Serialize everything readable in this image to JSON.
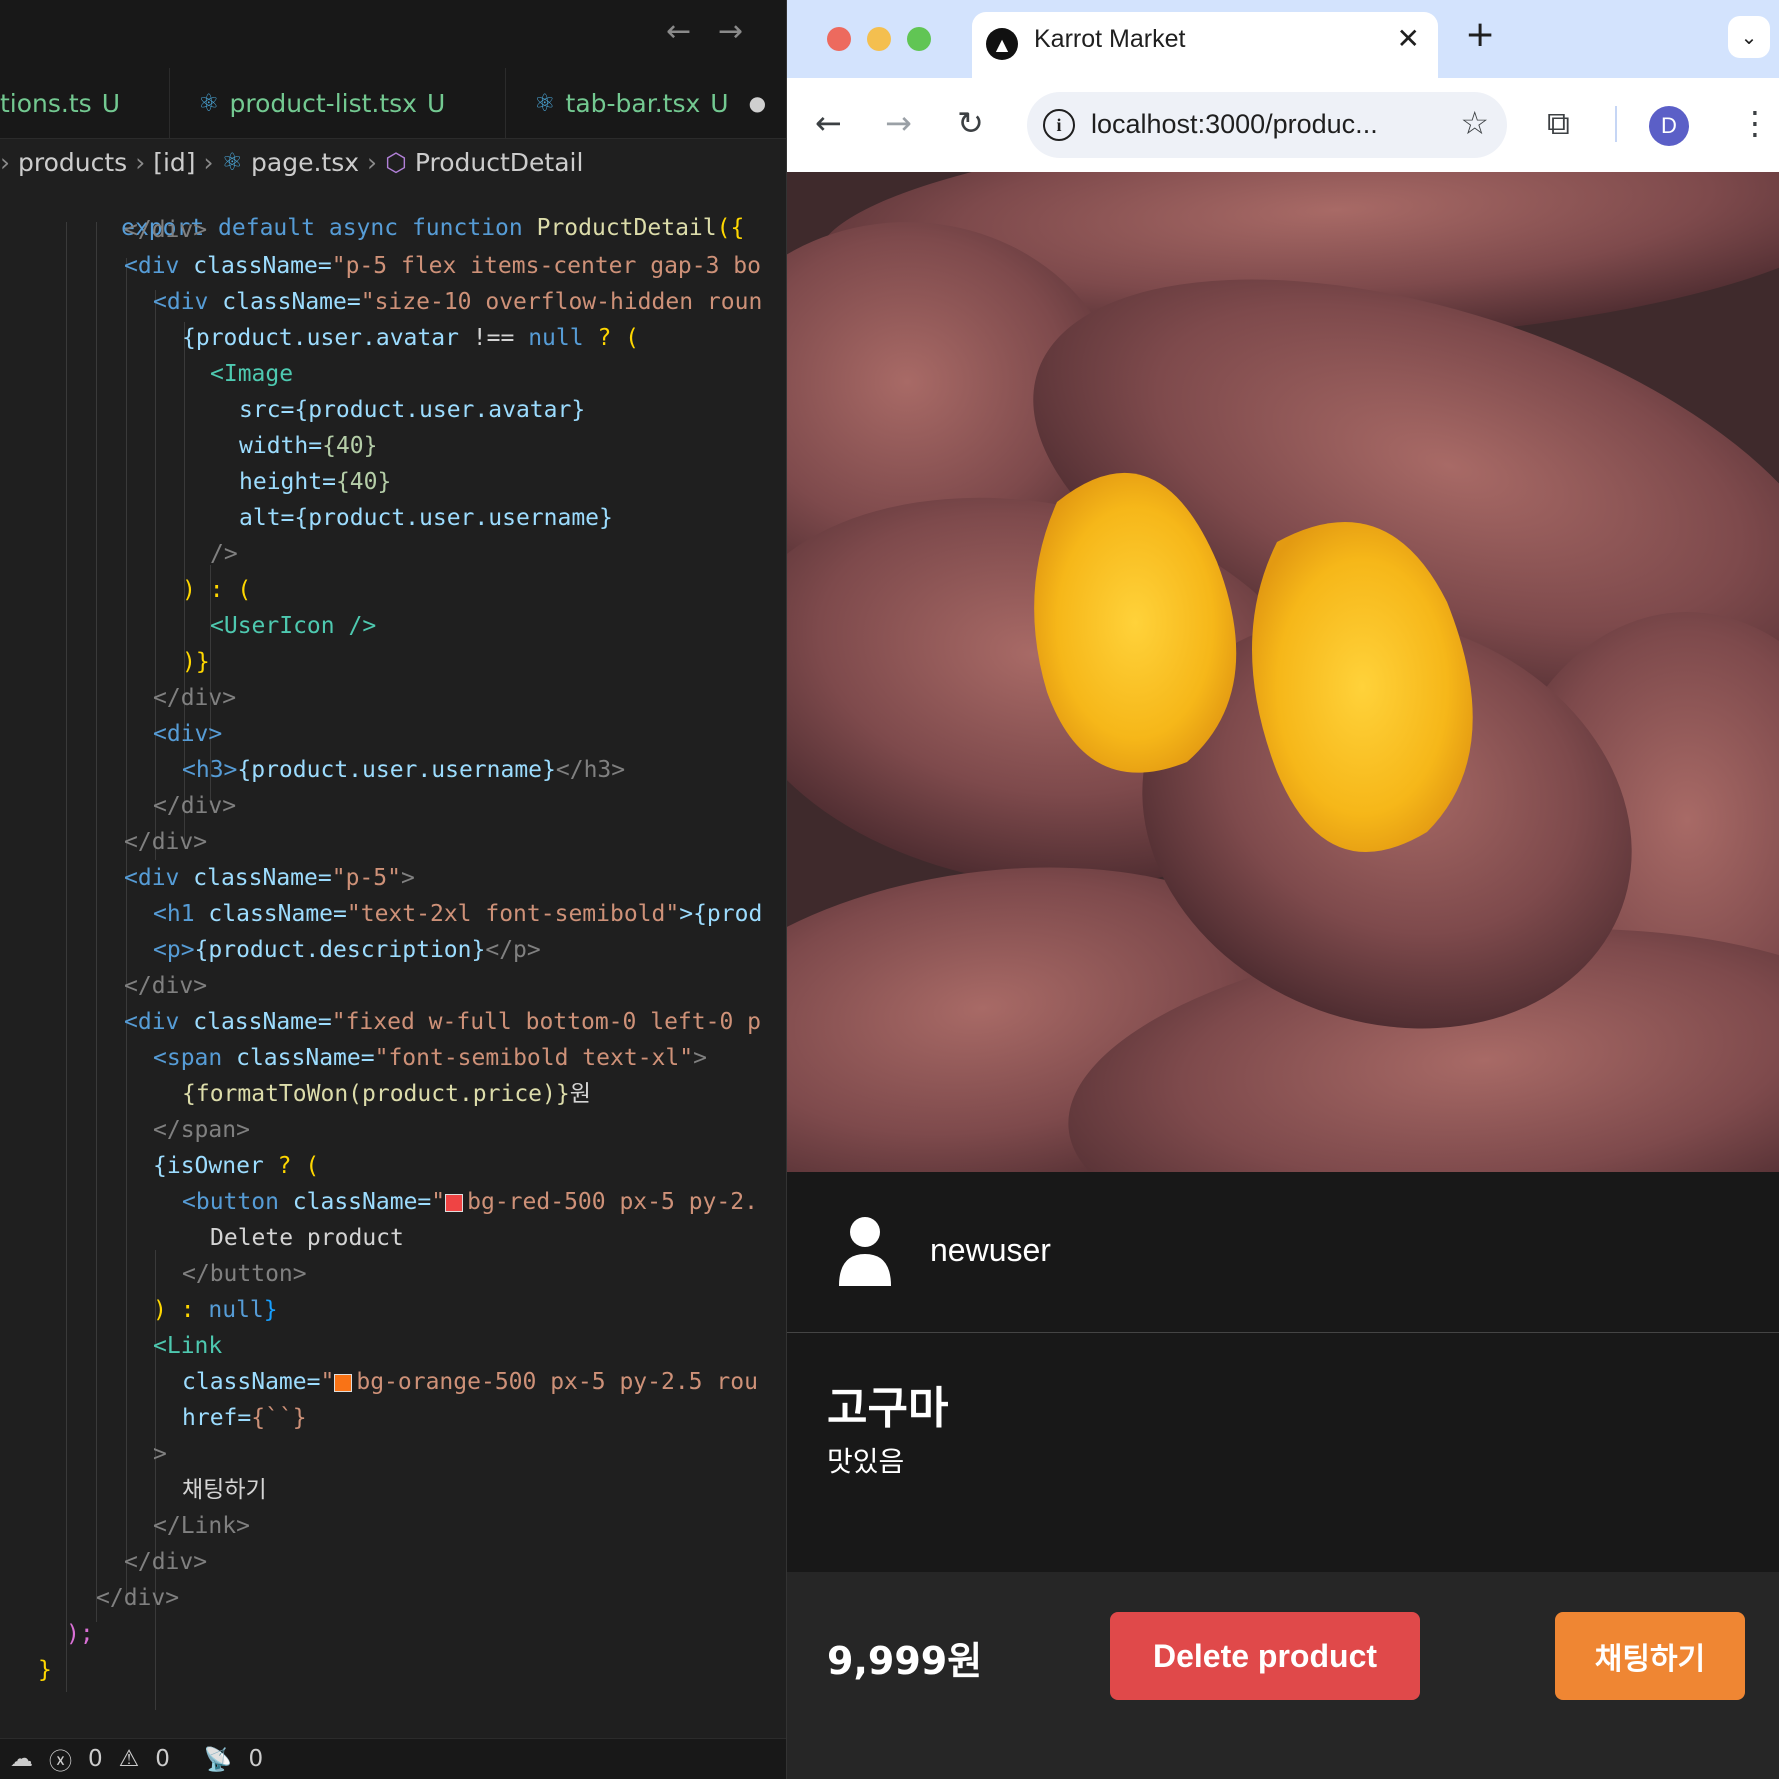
{
  "editor": {
    "tabs": [
      {
        "label": "tions.ts",
        "status": "U"
      },
      {
        "label": "product-list.tsx",
        "status": "U"
      },
      {
        "label": "tab-bar.tsx",
        "status": "U",
        "dot": "●"
      }
    ],
    "breadcrumb": [
      "products",
      "[id]",
      "page.tsx",
      "ProductDetail"
    ],
    "header_line": {
      "kw1": "export",
      "kw2": "default",
      "kw3": "async",
      "kw4": "function",
      "name": "ProductDetail",
      "tail": "({"
    },
    "code": {
      "l01": "</div>",
      "l02a": "<div",
      "l02b": "className=",
      "l02c": "\"p-5 flex items-center gap-3 bo",
      "l03a": "<div",
      "l03b": "className=",
      "l03c": "\"size-10 overflow-hidden roun",
      "l04a": "{product.user.avatar",
      "l04b": " !== ",
      "l04c": "null",
      "l04d": " ? (",
      "l05": "<Image",
      "l06a": "src=",
      "l06b": "{product.user.avatar}",
      "l07a": "width=",
      "l07b": "{40}",
      "l08a": "height=",
      "l08b": "{40}",
      "l09a": "alt=",
      "l09b": "{product.user.username}",
      "l10": "/>",
      "l11": ") : (",
      "l12": "<UserIcon />",
      "l13": ")}",
      "l14": "</div>",
      "l15": "<div>",
      "l16a": "<h3>",
      "l16b": "{product.user.username}",
      "l16c": "</h3>",
      "l17": "</div>",
      "l18": "</div>",
      "l19a": "<div",
      "l19b": "className=",
      "l19c": "\"p-5\"",
      "l19d": ">",
      "l20a": "<h1",
      "l20b": "className=",
      "l20c": "\"text-2xl font-semibold\"",
      "l20d": ">{prod",
      "l21a": "<p>",
      "l21b": "{product.description}",
      "l21c": "</p>",
      "l22": "</div>",
      "l23a": "<div",
      "l23b": "className=",
      "l23c": "\"fixed w-full bottom-0 left-0 p",
      "l24a": "<span",
      "l24b": "className=",
      "l24c": "\"font-semibold text-xl\"",
      "l24d": ">",
      "l25a": "{formatToWon(product.price)}",
      "l25b": "원",
      "l26": "</span>",
      "l27a": "{isOwner",
      "l27b": " ? (",
      "l28a": "<button",
      "l28b": "className=",
      "l28c": "\"",
      "l28d": "bg-red-500 px-5 py-2.",
      "l29": "Delete product",
      "l30": "</button>",
      "l31a": ") : ",
      "l31b": "null",
      "l31c": "}",
      "l32": "<Link",
      "l33a": "className=",
      "l33b": "\"",
      "l33c": "bg-orange-500 px-5 py-2.5 rou",
      "l34a": "href=",
      "l34b": "{``}",
      "l35": ">",
      "l36": "채팅하기",
      "l37": "</Link>",
      "l38": "</div>",
      "l39": "</div>",
      "l40": ");",
      "l41": "}"
    },
    "status": {
      "errors": "0",
      "warnings": "0",
      "ports": "0"
    }
  },
  "browser": {
    "tab_title": "Karrot Market",
    "url": "localhost:3000/produc...",
    "profile_initial": "D",
    "colors": {
      "tabstrip": "#d3e3fd",
      "close": "#ed6a5e",
      "minimize": "#f4bf4f",
      "maximize": "#61c554"
    }
  },
  "page": {
    "username": "newuser",
    "product_title": "고구마",
    "product_description": "맛있음",
    "price": "9,999원",
    "delete_label": "Delete product",
    "chat_label": "채팅하기",
    "colors": {
      "delete": "#e0494a",
      "chat": "#ef8633"
    }
  }
}
